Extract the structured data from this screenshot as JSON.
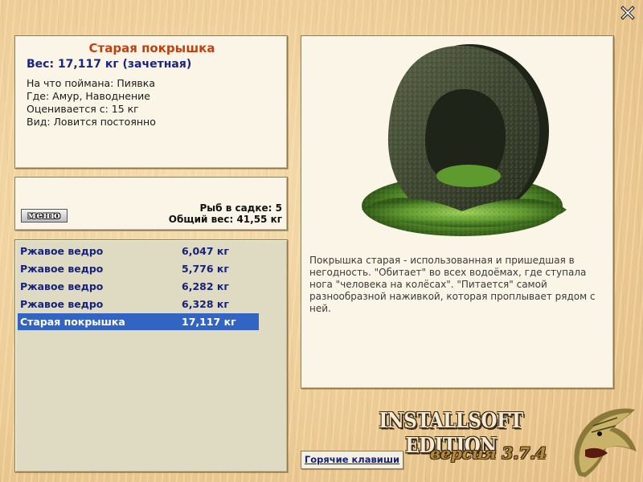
{
  "catch": {
    "title": "Старая покрышка",
    "weight_line": "Вес: 17,117 кг (зачетная)",
    "details": [
      "На что поймана: Пиявка",
      "Где: Амур, Наводнение",
      "Оценивается с: 15 кг",
      "Вид: Ловится постоянно"
    ]
  },
  "keepnet": {
    "menu_label": "меню",
    "count_line": "Рыб в садке: 5",
    "total_weight_line": "Общий вес: 41,55 кг"
  },
  "list": [
    {
      "name": "Ржавое ведро",
      "weight": "6,047 кг",
      "selected": false
    },
    {
      "name": "Ржавое ведро",
      "weight": "5,776 кг",
      "selected": false
    },
    {
      "name": "Ржавое ведро",
      "weight": "6,282 кг",
      "selected": false
    },
    {
      "name": "Ржавое ведро",
      "weight": "6,328 кг",
      "selected": false
    },
    {
      "name": "Старая покрышка",
      "weight": "17,117 кг",
      "selected": true
    }
  ],
  "description": "Покрышка старая - использованная и пришедшая в негодность. \"Обитает\" во всех водоёмах, где ступала нога \"человека на колёсах\". \"Питается\" самой разнообразной наживкой, которая проплывает рядом с ней.",
  "branding": {
    "edition": "INSTALLSOFT EDITION",
    "version": "версия 3.7.4"
  },
  "hotkeys_label": "Горячие клавиши",
  "icons": {
    "close": "close-icon",
    "fish_logo": "pike-fish-icon",
    "catch_image": "old-tire-image"
  },
  "colors": {
    "title_accent": "#c0410f",
    "text_blue": "#17227a",
    "selection": "#3264c4",
    "list_bg": "#dedbc2"
  }
}
